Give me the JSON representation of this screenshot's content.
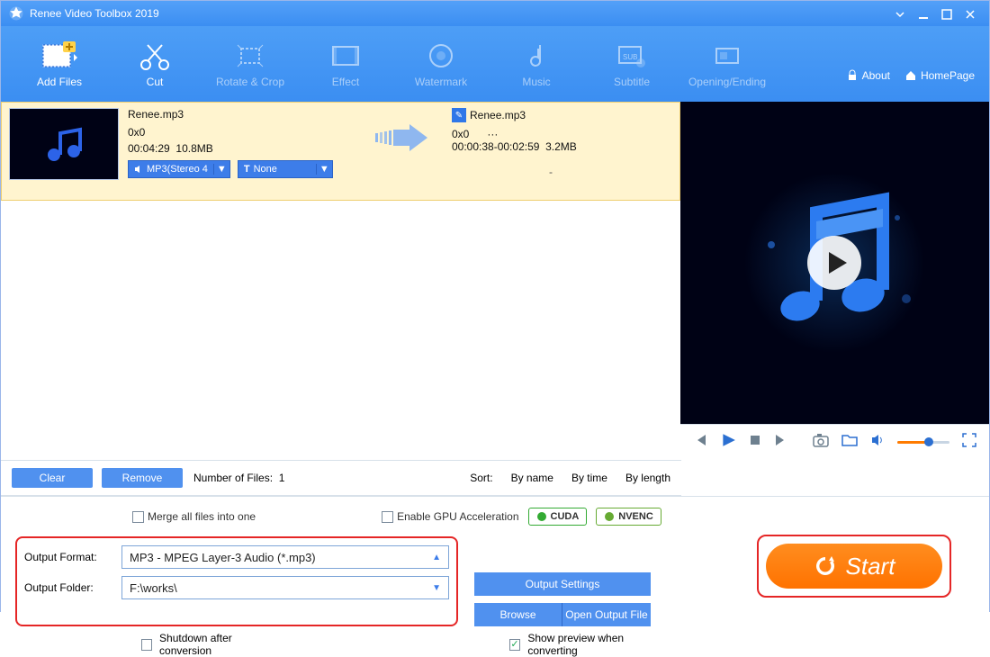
{
  "title": "Renee Video Toolbox 2019",
  "toolbar": [
    {
      "label": "Add Files",
      "active": true
    },
    {
      "label": "Cut",
      "active": true
    },
    {
      "label": "Rotate & Crop",
      "active": false
    },
    {
      "label": "Effect",
      "active": false
    },
    {
      "label": "Watermark",
      "active": false
    },
    {
      "label": "Music",
      "active": false
    },
    {
      "label": "Subtitle",
      "active": false
    },
    {
      "label": "Opening/Ending",
      "active": false
    }
  ],
  "links": {
    "about": "About",
    "home": "HomePage"
  },
  "task": {
    "in": {
      "name": "Renee.mp3",
      "dim": "0x0",
      "dur": "00:04:29",
      "size": "10.8MB"
    },
    "out": {
      "name": "Renee.mp3",
      "dim": "0x0",
      "dots": "···",
      "range": "00:00:38-00:02:59",
      "size": "3.2MB"
    },
    "chip_format": "MP3(Stereo 4",
    "chip_trim": "None",
    "dash": "-"
  },
  "list_footer": {
    "clear": "Clear",
    "remove": "Remove",
    "count_label": "Number of Files:",
    "count_value": "1",
    "sort_label": "Sort:",
    "sort_opts": [
      "By name",
      "By time",
      "By length"
    ]
  },
  "bottom": {
    "merge": "Merge all files into one",
    "gpu": "Enable GPU Acceleration",
    "cuda": "CUDA",
    "nvenc": "NVENC",
    "format_label": "Output Format:",
    "format_value": "MP3 - MPEG Layer-3 Audio (*.mp3)",
    "folder_label": "Output Folder:",
    "folder_value": "F:\\works\\",
    "settings": "Output Settings",
    "browse": "Browse",
    "openfile": "Open Output File",
    "shutdown": "Shutdown after conversion",
    "preview": "Show preview when converting",
    "start": "Start"
  }
}
